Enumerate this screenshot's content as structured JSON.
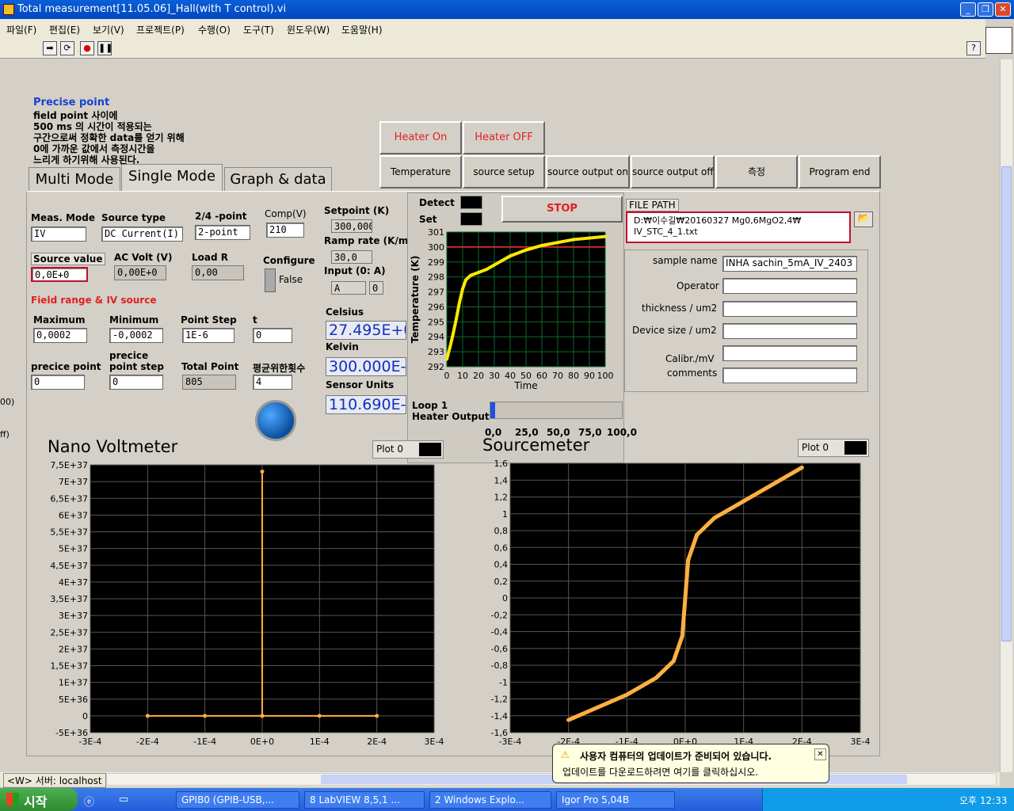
{
  "window": {
    "title": "Total measurement[11.05.06]_Hall(with T control).vi"
  },
  "menu": [
    "파일(F)",
    "편집(E)",
    "보기(V)",
    "프로젝트(P)",
    "수행(O)",
    "도구(T)",
    "윈도우(W)",
    "도움말(H)"
  ],
  "note": {
    "title": "Precise point",
    "lines": [
      "field point 사이에",
      "500 ms 의 시간이 적용되는",
      "구간으로써 정확한 data를 얻기 위해",
      "0에 가까운 값에서 측정시간을",
      "느리게 하기위해 사용된다."
    ]
  },
  "tabs": [
    "Multi Mode",
    "Single Mode",
    "Graph & data"
  ],
  "heater": {
    "on": "Heater On",
    "off": "Heater OFF"
  },
  "buttons": [
    "Temperature",
    "source setup",
    "source output on",
    "source output off",
    "측정",
    "Program end"
  ],
  "stop": "STOP",
  "meas": {
    "meas_mode_label": "Meas. Mode",
    "meas_mode": "IV",
    "source_type_label": "Source type",
    "source_type": "DC Current(I)",
    "point_label": "2/4 -point",
    "point": "2-point",
    "comp_label": "Comp(V)",
    "comp": "210",
    "source_value_label": "Source value",
    "source_value": "0,0E+0",
    "ac_volt_label": "AC Volt (V)",
    "ac_volt": "0,00E+0",
    "load_r_label": "Load R",
    "load_r": "0,00",
    "configure_label": "Configure",
    "configure": "False",
    "field_range_label": "Field range & IV source",
    "max_label": "Maximum",
    "max": "0,0002",
    "min_label": "Minimum",
    "min": "-0,0002",
    "step_label": "Point Step",
    "step": "1E-6",
    "t_label": "t",
    "t": "0",
    "precice_label": "precice point",
    "precice": "0",
    "precice_step_label1": "precice",
    "precice_step_label2": "point step",
    "precice_step": "0",
    "total_label": "Total Point",
    "total": "805",
    "avg_label": "평균위한횟수",
    "avg": "4"
  },
  "temp": {
    "setpoint_label": "Setpoint (K)",
    "setpoint": "300,000",
    "ramp_label": "Ramp rate (K/m",
    "ramp": "30,0",
    "input_label": "Input (0: A)",
    "input": "A",
    "input_num": "0",
    "celsius_label": "Celsius",
    "celsius": "27.495E+0",
    "kelvin_label": "Kelvin",
    "kelvin": "300.000E-",
    "sensor_label": "Sensor Units",
    "sensor": "110.690E-",
    "detect": "Detect",
    "set": "Set",
    "loop": "Loop 1",
    "heater_output": "Heater Output",
    "heater_ticks": [
      "0,0",
      "25,0",
      "50,0",
      "75,0",
      "100,0"
    ]
  },
  "file": {
    "label": "FILE PATH",
    "path1": "D:₩이수길₩20160327 Mg0,6MgO2,4₩",
    "path2": "IV_STC_4_1.txt"
  },
  "sample": {
    "labels": [
      "sample name",
      "Operator",
      "thickness / um2",
      "Device size / um2",
      "Calibr./mV",
      "comments"
    ],
    "values": [
      "INHA sachin_5mA_IV_2403",
      "",
      "",
      "",
      "",
      ""
    ]
  },
  "side": {
    "a": "00)",
    "b": "ff)"
  },
  "status": {
    "left": "<W> 서버: localhost"
  },
  "balloon": {
    "title": "사용자 컴퓨터의 업데이트가 준비되어 있습니다.",
    "body": "업데이트를 다운로드하려면 여기를 클릭하십시오."
  },
  "taskbar": {
    "start": "시작",
    "tasks": [
      "GPIB0 (GPIB-USB,...",
      "8 LabVIEW 8,5,1 ...",
      "2 Windows Explo...",
      "Igor Pro 5,04B"
    ],
    "clock": "오후 12:33"
  },
  "chart_data": [
    {
      "type": "line",
      "title": "",
      "ylabel": "Temperature (K)",
      "xlabel": "Time",
      "xlim": [
        0,
        100
      ],
      "ylim": [
        292,
        301
      ],
      "x_ticks": [
        "0",
        "10",
        "20",
        "30",
        "40",
        "50",
        "60",
        "70",
        "80",
        "90",
        "100"
      ],
      "y_ticks": [
        "292",
        "293",
        "294",
        "295",
        "296",
        "297",
        "298",
        "299",
        "300",
        "301"
      ],
      "setpoint": 300,
      "x": [
        0,
        2,
        4,
        6,
        8,
        10,
        12,
        15,
        20,
        25,
        30,
        40,
        50,
        60,
        70,
        80,
        90,
        100
      ],
      "values": [
        292.5,
        293.3,
        294.2,
        295.2,
        296.3,
        297.2,
        297.8,
        298.1,
        298.3,
        298.5,
        298.8,
        299.4,
        299.8,
        300.1,
        300.3,
        300.5,
        300.6,
        300.7
      ]
    },
    {
      "type": "line",
      "title": "Nano Voltmeter",
      "legend": "Plot 0",
      "xlim": [
        -0.0003,
        0.0003
      ],
      "ylim": [
        -5e+36,
        7.5e+37
      ],
      "x_ticks": [
        "-3E-4",
        "-2E-4",
        "-1E-4",
        "0E+0",
        "1E-4",
        "2E-4",
        "3E-4"
      ],
      "y_ticks": [
        "-5E+36",
        "0",
        "5E+36",
        "1E+37",
        "1,5E+37",
        "2E+37",
        "2,5E+37",
        "3E+37",
        "3,5E+37",
        "4E+37",
        "4,5E+37",
        "5E+37",
        "5,5E+37",
        "6E+37",
        "6,5E+37",
        "7E+37",
        "7,5E+37"
      ],
      "x": [
        -0.0002,
        -0.0001,
        0,
        0,
        0,
        0.0001,
        0.0002
      ],
      "values": [
        0,
        0,
        0,
        7.3e+37,
        0,
        0,
        0
      ]
    },
    {
      "type": "line",
      "title": "Sourcemeter",
      "legend": "Plot 0",
      "xlim": [
        -0.0003,
        0.0003
      ],
      "ylim": [
        -1.6,
        1.6
      ],
      "x_ticks": [
        "-3E-4",
        "-2E-4",
        "-1E-4",
        "0E+0",
        "1E-4",
        "2E-4",
        "3E-4"
      ],
      "y_ticks": [
        "-1,6",
        "-1,4",
        "-1,2",
        "-1",
        "-0,8",
        "-0,6",
        "-0,4",
        "-0,2",
        "0",
        "0,2",
        "0,4",
        "0,6",
        "0,8",
        "1",
        "1,2",
        "1,4",
        "1,6"
      ],
      "x": [
        -0.0002,
        -0.00015,
        -0.0001,
        -5e-05,
        -2e-05,
        -5e-06,
        0,
        5e-06,
        2e-05,
        5e-05,
        0.0001,
        0.00015,
        0.0002
      ],
      "values": [
        -1.45,
        -1.3,
        -1.15,
        -0.95,
        -0.75,
        -0.45,
        0,
        0.45,
        0.75,
        0.95,
        1.15,
        1.35,
        1.55
      ]
    }
  ]
}
